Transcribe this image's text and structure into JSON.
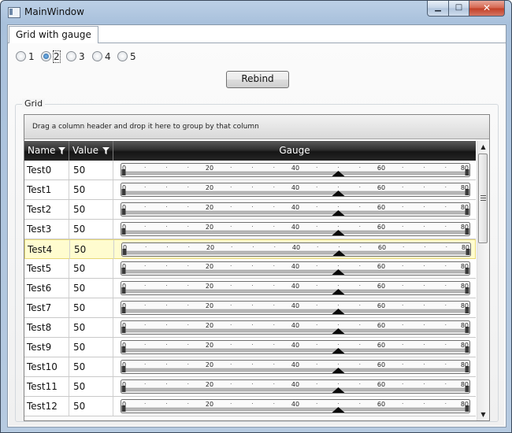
{
  "window": {
    "title": "MainWindow",
    "minimize": "▁",
    "maximize": "□",
    "close": "✕"
  },
  "tab": {
    "label": "Grid with gauge"
  },
  "radios": [
    {
      "label": "1",
      "checked": false
    },
    {
      "label": "2",
      "checked": true
    },
    {
      "label": "3",
      "checked": false
    },
    {
      "label": "4",
      "checked": false
    },
    {
      "label": "5",
      "checked": false
    }
  ],
  "rebind_label": "Rebind",
  "group": {
    "label": "Grid",
    "hint": "Drag a column header and drop it here to group by that column"
  },
  "columns": {
    "name": "Name",
    "value": "Value",
    "gauge": "Gauge"
  },
  "gauge": {
    "min": 0,
    "max": 80,
    "ticks": [
      "0",
      "20",
      "40",
      "60",
      "80"
    ]
  },
  "rows": [
    {
      "name": "Test0",
      "value": "50"
    },
    {
      "name": "Test1",
      "value": "50"
    },
    {
      "name": "Test2",
      "value": "50"
    },
    {
      "name": "Test3",
      "value": "50"
    },
    {
      "name": "Test4",
      "value": "50",
      "selected": true
    },
    {
      "name": "Test5",
      "value": "50"
    },
    {
      "name": "Test6",
      "value": "50"
    },
    {
      "name": "Test7",
      "value": "50"
    },
    {
      "name": "Test8",
      "value": "50"
    },
    {
      "name": "Test9",
      "value": "50"
    },
    {
      "name": "Test10",
      "value": "50"
    },
    {
      "name": "Test11",
      "value": "50"
    },
    {
      "name": "Test12",
      "value": "50"
    }
  ],
  "scrollbar": {
    "up": "▲",
    "down": "▼"
  },
  "colors": {
    "selected_row": "#fffccf",
    "header": "#1b1b1b"
  }
}
